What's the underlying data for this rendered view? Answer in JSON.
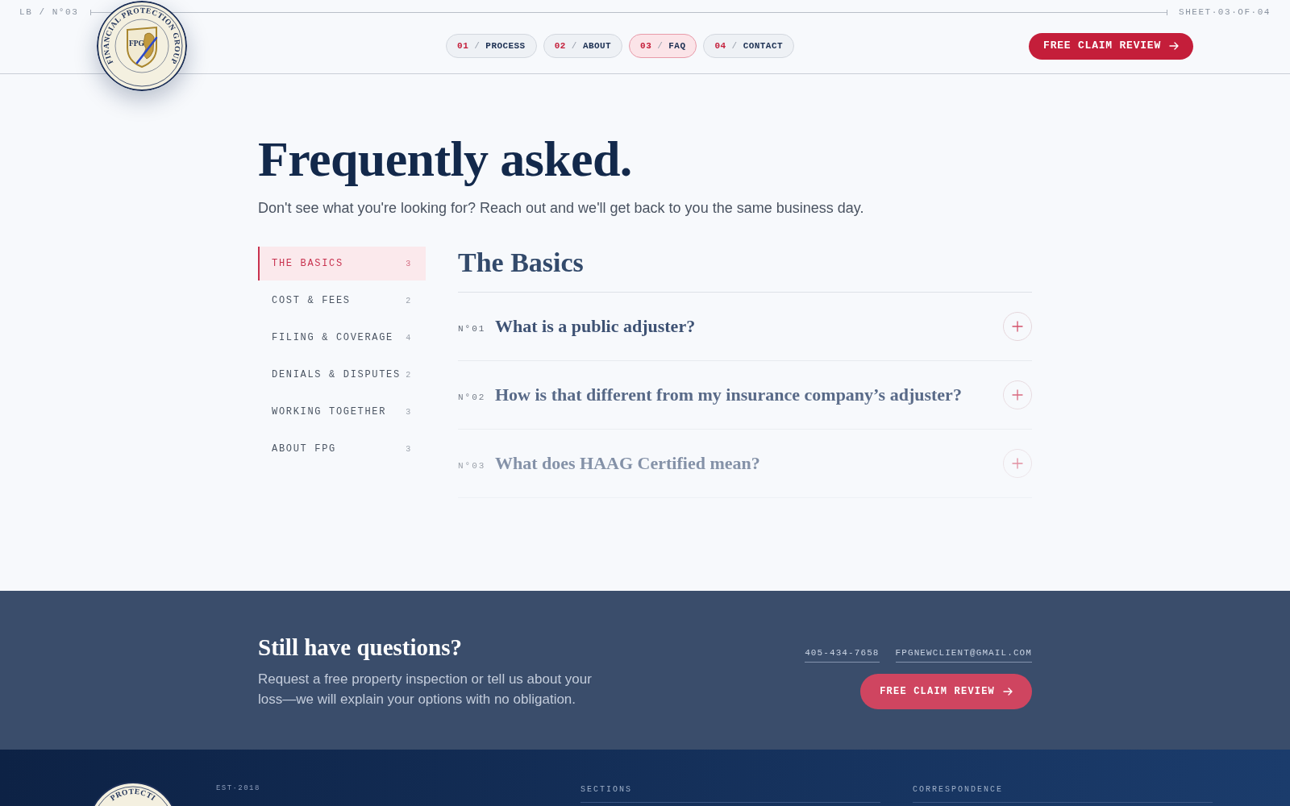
{
  "header": {
    "sheet_id": "LB / N°03",
    "sheet_count": "SHEET·03·OF·04",
    "logo": {
      "ring_text": "FINANCIAL PROTECTION GROUP",
      "shield_text": "FPG"
    },
    "nav": [
      {
        "number": "01",
        "separator": "/",
        "label": "PROCESS",
        "selected": false
      },
      {
        "number": "02",
        "separator": "/",
        "label": "ABOUT",
        "selected": false
      },
      {
        "number": "03",
        "separator": "/",
        "label": "FAQ",
        "selected": true
      },
      {
        "number": "04",
        "separator": "/",
        "label": "CONTACT",
        "selected": false
      }
    ],
    "cta": "FREE CLAIM REVIEW"
  },
  "faq": {
    "title": "Frequently asked.",
    "intro": "Don't see what you're looking for? Reach out and we'll get back to you the same business day.",
    "categories": [
      {
        "label": "THE BASICS",
        "count": "3",
        "selected": true
      },
      {
        "label": "COST & FEES",
        "count": "2",
        "selected": false
      },
      {
        "label": "FILING & COVERAGE",
        "count": "4",
        "selected": false
      },
      {
        "label": "DENIALS & DISPUTES",
        "count": "2",
        "selected": false
      },
      {
        "label": "WORKING TOGETHER",
        "count": "3",
        "selected": false
      },
      {
        "label": "ABOUT FPG",
        "count": "3",
        "selected": false
      }
    ],
    "section_title": "The Basics",
    "questions": [
      {
        "number": "N°01",
        "question": "What is a public adjuster?",
        "expanded": false
      },
      {
        "number": "N°02",
        "question": "How is that different from my insurance company’s adjuster?",
        "expanded": false
      },
      {
        "number": "N°03",
        "question": "What does HAAG Certified mean?",
        "expanded": false
      }
    ]
  },
  "contact_band": {
    "title": "Still have questions?",
    "text": "Request a free property inspection or tell us about your loss—we will explain your options with no obligation.",
    "phone": "405-434-7658",
    "email": "FPGNEWCLIENT@GMAIL.COM",
    "cta": "FREE CLAIM REVIEW"
  },
  "footer": {
    "logo": {
      "ring_text": "PROTECTI"
    },
    "est": "EST·2018",
    "columns": [
      {
        "heading": "SECTIONS"
      },
      {
        "heading": "CORRESPONDENCE"
      }
    ]
  }
}
